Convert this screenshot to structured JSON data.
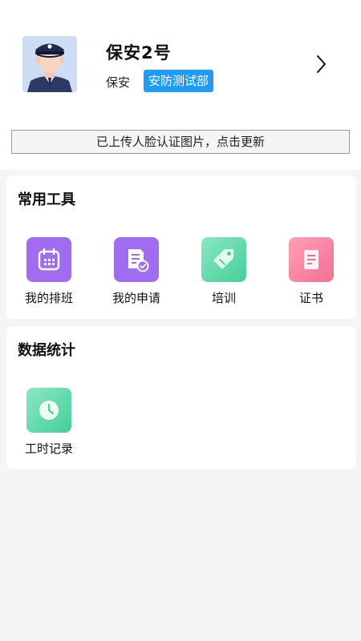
{
  "profile": {
    "name": "保安2号",
    "role": "保安",
    "department": "安防测试部"
  },
  "face_banner": {
    "text": "已上传人脸认证图片，点击更新"
  },
  "tools": {
    "title": "常用工具",
    "items": [
      {
        "label": "我的排班",
        "icon": "calendar-icon",
        "color": "#9f6cf2"
      },
      {
        "label": "我的申请",
        "icon": "application-doc-icon",
        "color": "#9f6cf2"
      },
      {
        "label": "培训",
        "icon": "tag-icon",
        "color": "#44cf9b"
      },
      {
        "label": "证书",
        "icon": "certificate-icon",
        "color": "#f56f92"
      }
    ]
  },
  "stats": {
    "title": "数据统计",
    "items": [
      {
        "label": "工时记录",
        "icon": "clock-icon",
        "color": "#44cf9b"
      }
    ]
  },
  "colors": {
    "badge": "#1e9bff",
    "background": "#f5f5f5"
  }
}
